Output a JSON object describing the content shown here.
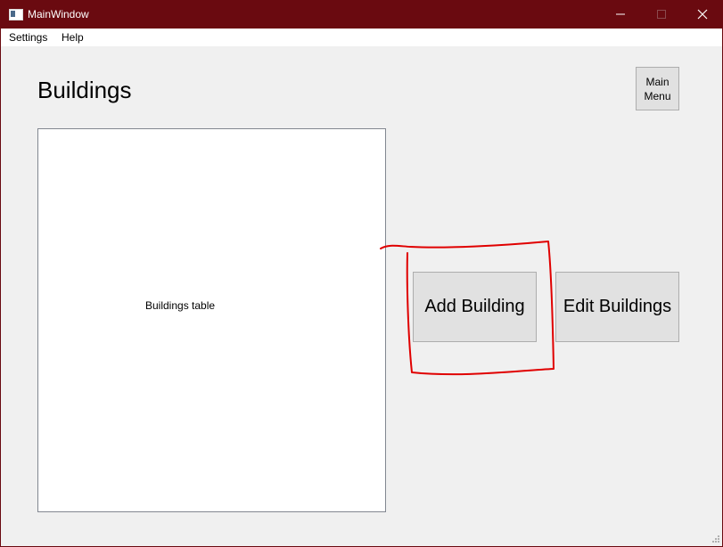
{
  "window": {
    "title": "MainWindow",
    "icons": {
      "app": "window-icon",
      "minimize": "minimize-icon",
      "maximize": "maximize-icon",
      "close": "close-icon"
    },
    "colors": {
      "titlebar": "#6a0a10",
      "client": "#f0f0f0",
      "button_face": "#e1e1e1",
      "annotation": "#e00000"
    }
  },
  "menubar": {
    "items": [
      {
        "label": "Settings"
      },
      {
        "label": "Help"
      }
    ]
  },
  "page": {
    "title": "Buildings",
    "main_menu": {
      "line1": "Main",
      "line2": "Menu"
    },
    "table": {
      "label": "Buildings table"
    },
    "add_building_label": "Add Building",
    "edit_buildings_label": "Edit Buildings"
  }
}
